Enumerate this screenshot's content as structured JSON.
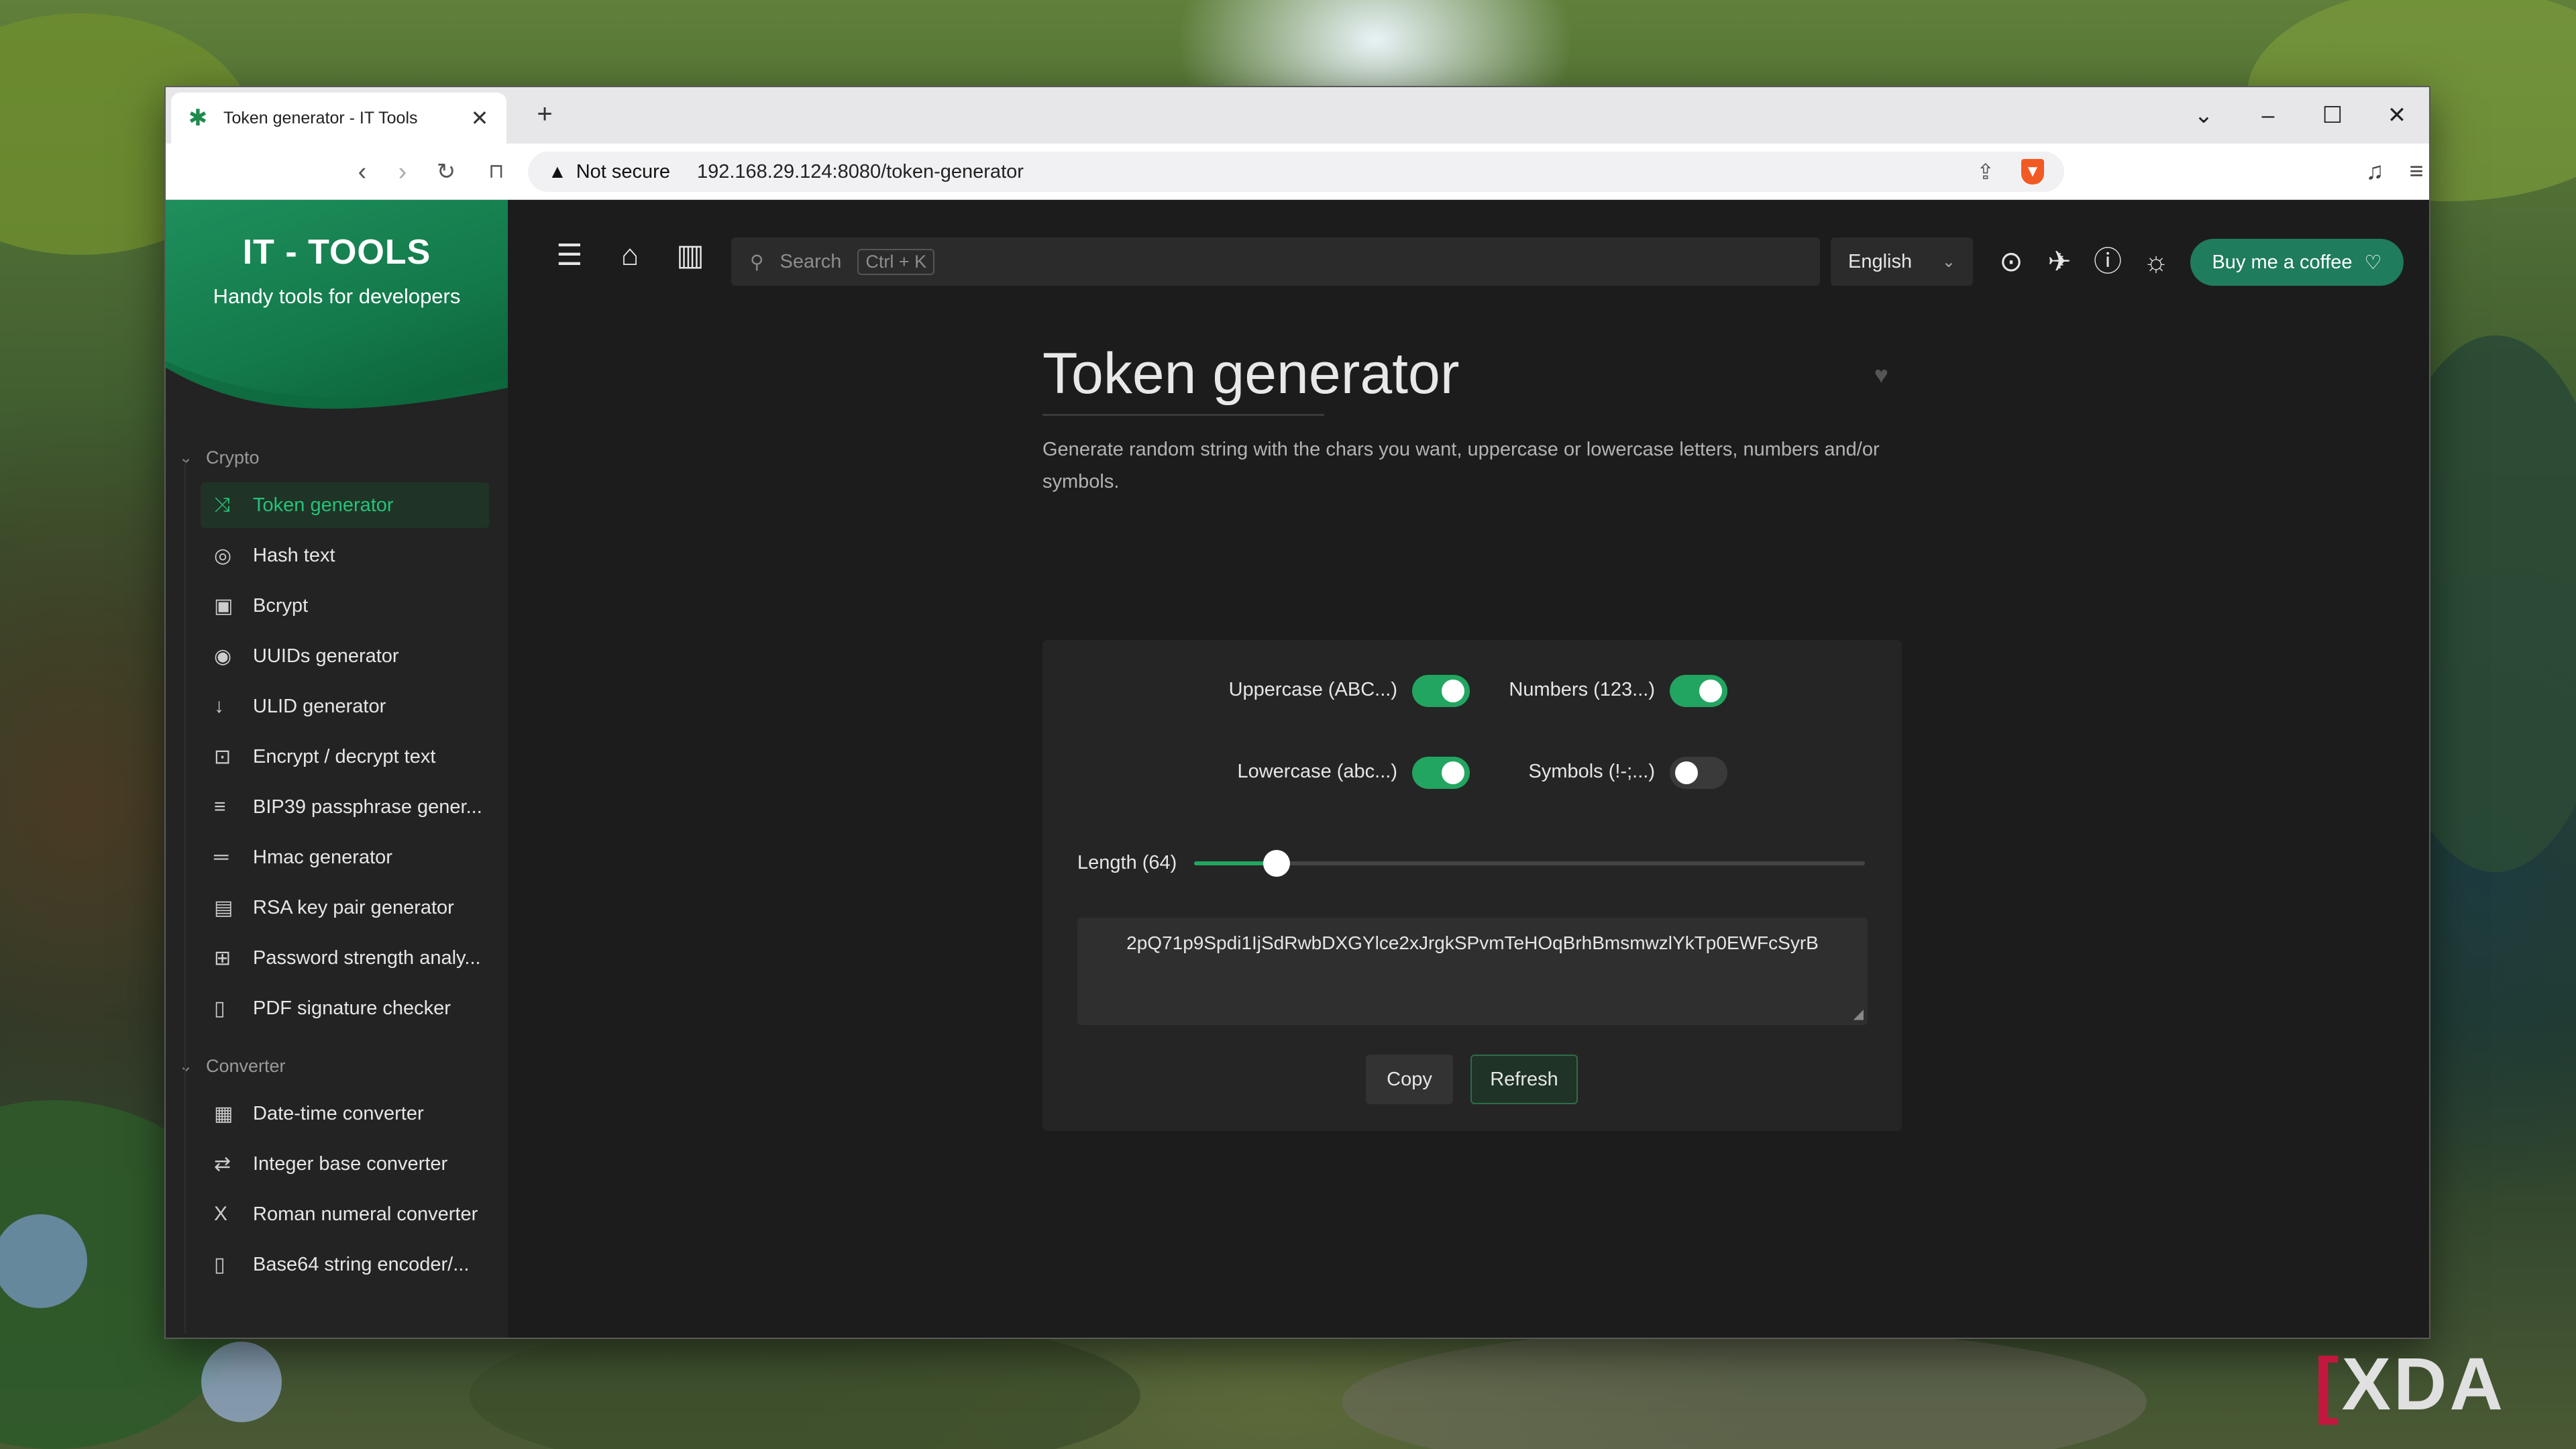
{
  "browser": {
    "tab_title": "Token generator - IT Tools",
    "tab_close": "✕",
    "new_tab": "+",
    "address": {
      "security_warning": "Not secure",
      "url": "192.168.29.124:8080/token-generator"
    }
  },
  "sidebar": {
    "app_name": "IT - TOOLS",
    "tagline": "Handy tools for developers",
    "sections": [
      {
        "title": "Crypto",
        "items": [
          {
            "label": "Token generator",
            "icon": "shuffle-icon",
            "active": true
          },
          {
            "label": "Hash text",
            "icon": "eye-off-icon"
          },
          {
            "label": "Bcrypt",
            "icon": "lock-square-icon"
          },
          {
            "label": "UUIDs generator",
            "icon": "fingerprint-icon"
          },
          {
            "label": "ULID generator",
            "icon": "sort-numbers-icon"
          },
          {
            "label": "Encrypt / decrypt text",
            "icon": "lock-icon"
          },
          {
            "label": "BIP39 passphrase gener...",
            "icon": "list-icon"
          },
          {
            "label": "Hmac generator",
            "icon": "short-text-icon"
          },
          {
            "label": "RSA key pair generator",
            "icon": "certificate-icon"
          },
          {
            "label": "Password strength analy...",
            "icon": "password-icon"
          },
          {
            "label": "PDF signature checker",
            "icon": "file-certificate-icon"
          }
        ]
      },
      {
        "title": "Converter",
        "items": [
          {
            "label": "Date-time converter",
            "icon": "calendar-icon"
          },
          {
            "label": "Integer base converter",
            "icon": "arrows-left-right-icon"
          },
          {
            "label": "Roman numeral converter",
            "icon": "letter-x-icon"
          },
          {
            "label": "Base64 string encoder/...",
            "icon": "file-digit-icon"
          }
        ]
      }
    ]
  },
  "appbar": {
    "search_placeholder": "Search",
    "search_shortcut": "Ctrl + K",
    "language": "English",
    "coffee_button": "Buy me a coffee"
  },
  "page": {
    "title": "Token generator",
    "description": "Generate random string with the chars you want, uppercase or lowercase letters, numbers and/or symbols."
  },
  "options": {
    "uppercase": {
      "label": "Uppercase (ABC...)",
      "enabled": true
    },
    "numbers": {
      "label": "Numbers (123...)",
      "enabled": true
    },
    "lowercase": {
      "label": "Lowercase (abc...)",
      "enabled": true
    },
    "symbols": {
      "label": "Symbols (!-;...)",
      "enabled": false
    }
  },
  "length": {
    "label": "Length (64)",
    "value": 64,
    "min": 1,
    "max": 512
  },
  "token": "2pQ71p9Spdi1IjSdRwbDXGYlce2xJrgkSPvmTeHOqBrhBmsmwzlYkTp0EWFcSyrB",
  "buttons": {
    "copy": "Copy",
    "refresh": "Refresh"
  },
  "watermark": {
    "bracket": "[",
    "text": "XDA"
  },
  "colors": {
    "accent": "#22a560",
    "active_text": "#26c27a",
    "coffee": "#1f7c5d",
    "brave_shield": "#f25a23"
  }
}
